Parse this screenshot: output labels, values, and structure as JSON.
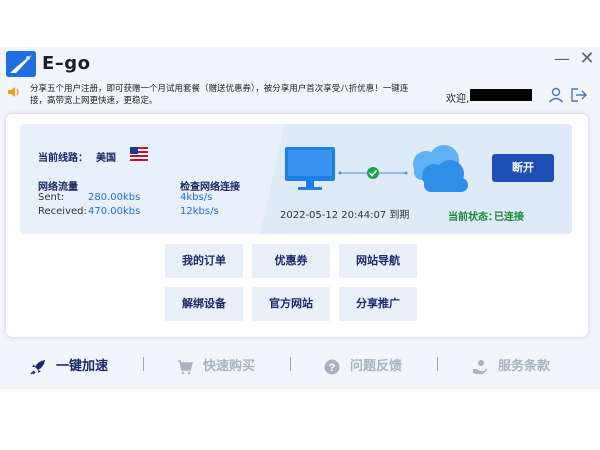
{
  "window": {
    "title": "E–go",
    "minimize": "—",
    "close": "✕"
  },
  "notice": "分享五个用户注册，即可获赠一个月试用套餐（赠送优惠券），被分享用户首次享受八折优惠！一键连接，高带宽上网更快速，更稳定。",
  "welcome": "欢迎,",
  "line": {
    "label": "当前线路：",
    "value": "美国"
  },
  "traffic": {
    "title": "网络流量",
    "sent_label": "Sent:",
    "sent_value": "280.00kbs",
    "received_label": "Received:",
    "received_value": "470.00kbs"
  },
  "check": {
    "title": "检查网络连接",
    "v1": "4kbs/s",
    "v2": "12kbs/s"
  },
  "expire": "2022-05-12 20:44:07 到期",
  "disconnect": "断开",
  "status": {
    "label": "当前状态：",
    "value": "已连接"
  },
  "grid": [
    {
      "label": "我的订单"
    },
    {
      "label": "优惠券"
    },
    {
      "label": "网站导航"
    },
    {
      "label": "解绑设备"
    },
    {
      "label": "官方网站"
    },
    {
      "label": "分享推广"
    }
  ],
  "nav": [
    {
      "label": "一键加速",
      "icon": "rocket-icon",
      "active": true
    },
    {
      "label": "快速购买",
      "icon": "cart-icon",
      "active": false
    },
    {
      "label": "问题反馈",
      "icon": "question-icon",
      "active": false
    },
    {
      "label": "服务条款",
      "icon": "service-icon",
      "active": false
    }
  ],
  "colors": {
    "accent": "#1f6fe0",
    "button": "#1e4fb8",
    "connected": "#1a8a3a",
    "nav_active": "#1a2a6c",
    "nav_inactive": "#a9b3c2"
  }
}
